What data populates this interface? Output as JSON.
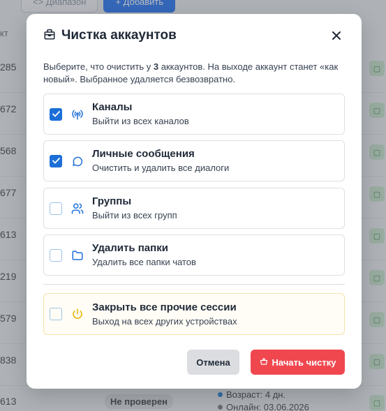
{
  "background": {
    "toolbar": {
      "range_label": "<> Диапазон",
      "add_label": "+ Добавить"
    },
    "column_header": "кт",
    "rows": [
      "285",
      "672",
      "568",
      "677",
      "613",
      "219",
      "579",
      "838",
      "613"
    ],
    "badge": "Не проверен",
    "meta": {
      "age": "Возраст: 4 дн.",
      "online": "Онлайн: 03.06.2026"
    }
  },
  "modal": {
    "title": "Чистка аккаунтов",
    "description_prefix": "Выберите, что очистить у ",
    "description_count": "3",
    "description_suffix": " аккаунтов. На выходе аккаунт станет «как новый». Выбранное удаляется безвозвратно.",
    "options": [
      {
        "title": "Каналы",
        "subtitle": "Выйти из всех каналов",
        "checked": true,
        "icon": "broadcast-icon"
      },
      {
        "title": "Личные сообщения",
        "subtitle": "Очистить и удалить все диалоги",
        "checked": true,
        "icon": "chat-bubble-icon"
      },
      {
        "title": "Группы",
        "subtitle": "Выйти из всех групп",
        "checked": false,
        "icon": "users-icon"
      },
      {
        "title": "Удалить папки",
        "subtitle": "Удалить все папки чатов",
        "checked": false,
        "icon": "folder-icon"
      },
      {
        "title": "Закрыть все прочие сессии",
        "subtitle": "Выход на всех других устройствах",
        "checked": false,
        "icon": "power-icon"
      }
    ],
    "cancel_label": "Отмена",
    "start_label": "Начать чистку"
  },
  "colors": {
    "accent": "#1d6fd8",
    "danger": "#f0474f",
    "warning": "#e8b400"
  }
}
